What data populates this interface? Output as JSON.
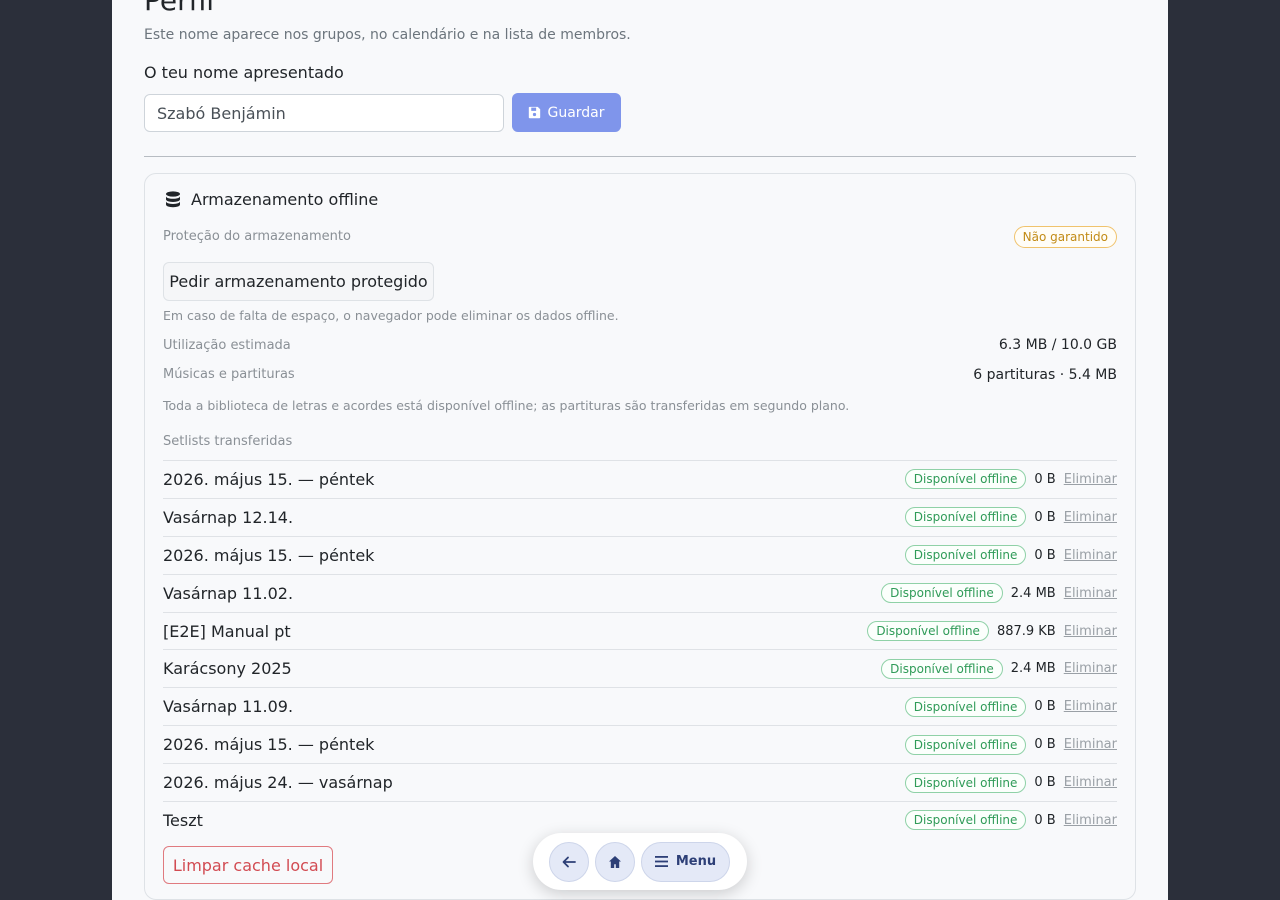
{
  "profile": {
    "title": "Perfil",
    "subtitle": "Este nome aparece nos grupos, no calendário e na lista de membros.",
    "name_label": "O teu nome apresentado",
    "name_value": "Szabó Benjámin",
    "save_label": "Guardar"
  },
  "storage": {
    "header": "Armazenamento offline",
    "protection_label": "Proteção do armazenamento",
    "protection_status": "Não garantido",
    "protect_button": "Pedir armazenamento protegido",
    "protect_note": "Em caso de falta de espaço, o navegador pode eliminar os dados offline.",
    "usage_label": "Utilização estimada",
    "usage_value": "6.3 MB / 10.0 GB",
    "music_label": "Músicas e partituras",
    "music_value": "6 partituras · 5.4 MB",
    "library_note": "Toda a biblioteca de letras e acordes está disponível offline; as partituras são transferidas em segundo plano.",
    "setlists_label": "Setlists transferidas",
    "setlists": [
      {
        "name": "2026. május 15. — péntek",
        "status": "Disponível offline",
        "size": "0 B",
        "delete": "Eliminar"
      },
      {
        "name": "Vasárnap 12.14.",
        "status": "Disponível offline",
        "size": "0 B",
        "delete": "Eliminar"
      },
      {
        "name": "2026. május 15. — péntek",
        "status": "Disponível offline",
        "size": "0 B",
        "delete": "Eliminar"
      },
      {
        "name": "Vasárnap 11.02.",
        "status": "Disponível offline",
        "size": "2.4 MB",
        "delete": "Eliminar"
      },
      {
        "name": "[E2E] Manual pt",
        "status": "Disponível offline",
        "size": "887.9 KB",
        "delete": "Eliminar"
      },
      {
        "name": "Karácsony 2025",
        "status": "Disponível offline",
        "size": "2.4 MB",
        "delete": "Eliminar"
      },
      {
        "name": "Vasárnap 11.09.",
        "status": "Disponível offline",
        "size": "0 B",
        "delete": "Eliminar"
      },
      {
        "name": "2026. május 15. — péntek",
        "status": "Disponível offline",
        "size": "0 B",
        "delete": "Eliminar"
      },
      {
        "name": "2026. május 24. — vasárnap",
        "status": "Disponível offline",
        "size": "0 B",
        "delete": "Eliminar"
      },
      {
        "name": "Teszt",
        "status": "Disponível offline",
        "size": "0 B",
        "delete": "Eliminar"
      }
    ],
    "clear_button": "Limpar cache local"
  },
  "nav": {
    "back_icon": "arrow-left-icon",
    "home_icon": "home-icon",
    "menu_label": "Menu"
  },
  "colors": {
    "accent": "#7f95eb",
    "danger": "#d24b52",
    "success": "#2f9b58",
    "warning": "#c28b16",
    "background": "#2b2f3a"
  }
}
